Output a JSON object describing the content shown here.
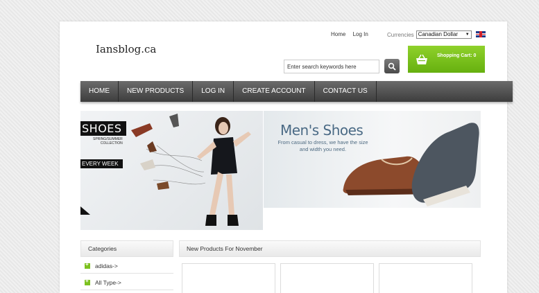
{
  "site": {
    "logo": "Iansblog.ca"
  },
  "header": {
    "links": [
      "Home",
      "Log In"
    ],
    "currencies_label": "Currencies",
    "currency_selected": "Canadian Dollar",
    "search_placeholder": "Enter search keywords here",
    "cart_label": "Shopping Cart: 0"
  },
  "nav": {
    "items": [
      "HOME",
      "NEW PRODUCTS",
      "LOG IN",
      "CREATE ACCOUNT",
      "CONTACT US"
    ]
  },
  "banner_left": {
    "title": "SHOES",
    "collection_line1": "SPRING/SUMMER",
    "collection_line2": "COLLECTION",
    "tag": "EVERY WEEK"
  },
  "banner_right": {
    "title": "Men's Shoes",
    "subtitle": "From casual to dress, we have the size and width you need."
  },
  "sidebar": {
    "header": "Categories",
    "items": [
      "adidas->",
      "All Type->"
    ]
  },
  "main": {
    "header": "New Products For November"
  },
  "colors": {
    "accent_green": "#7cc11e",
    "nav_dark": "#4a4a4a",
    "banner_text_blue": "#4a6a85"
  },
  "icons": {
    "search": "search-icon",
    "cart": "basket-icon",
    "flag": "uk-flag-icon"
  }
}
